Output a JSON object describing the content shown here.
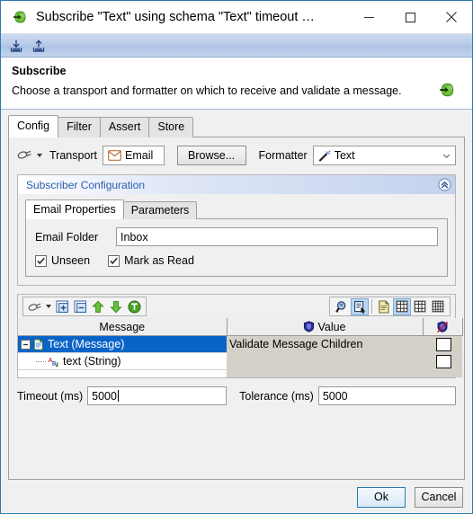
{
  "window": {
    "title": "Subscribe \"Text\" using schema \"Text\" timeout …",
    "title_icon": "green-arrow-icon",
    "minimize_label": "—",
    "maximize_label": "□",
    "close_label": "✕"
  },
  "toolbar": {
    "items": [
      {
        "name": "import-icon",
        "tooltip": "Import"
      },
      {
        "name": "export-icon",
        "tooltip": "Export"
      }
    ]
  },
  "banner": {
    "title": "Subscribe",
    "description": "Choose a transport and formatter on which to receive and validate a message.",
    "icon": "green-arrow-icon"
  },
  "tabs": [
    {
      "label": "Config",
      "active": true
    },
    {
      "label": "Filter",
      "active": false
    },
    {
      "label": "Assert",
      "active": false
    },
    {
      "label": "Store",
      "active": false
    }
  ],
  "config": {
    "pipe_icon": "pipe-icon",
    "transport_label": "Transport",
    "transport_value": "Email",
    "transport_icon": "email-icon",
    "browse_label": "Browse...",
    "formatter_label": "Formatter",
    "formatter_value": "Text",
    "formatter_icon": "magic-wand-icon",
    "group": {
      "title": "Subscriber Configuration",
      "collapse_icon": "chevron-up-double-icon",
      "tabs": [
        {
          "label": "Email Properties",
          "active": true
        },
        {
          "label": "Parameters",
          "active": false
        }
      ],
      "email_folder_label": "Email Folder",
      "email_folder_value": "Inbox",
      "email_folder_placeholder": "",
      "checkboxes": [
        {
          "label": "Unseen",
          "checked": true
        },
        {
          "label": "Mark as Read",
          "checked": true
        }
      ]
    },
    "message_panel": {
      "left_tools": [
        {
          "name": "pipe-icon"
        },
        {
          "name": "chevron-down-icon"
        },
        {
          "name": "add-node-icon"
        },
        {
          "name": "remove-node-icon"
        },
        {
          "name": "move-up-icon"
        },
        {
          "name": "move-down-icon"
        },
        {
          "name": "validate-icon"
        }
      ],
      "right_tools": [
        {
          "name": "zoom-icon",
          "selected": false
        },
        {
          "name": "inspect-icon",
          "selected": true
        },
        {
          "name": "document-icon",
          "selected": false
        },
        {
          "name": "grid-small-icon",
          "selected": true
        },
        {
          "name": "grid-medium-icon",
          "selected": false
        },
        {
          "name": "grid-large-icon",
          "selected": false
        }
      ],
      "columns": [
        {
          "label": "Message",
          "icon": ""
        },
        {
          "label": "Value",
          "icon": "shield-icon"
        },
        {
          "label": "",
          "icon": "shield-disabled-icon"
        }
      ],
      "rows": [
        {
          "name": "Text (Message)",
          "icon": "message-document-icon",
          "expanded": true,
          "selected": true,
          "value": "Validate Message Children",
          "checked": false,
          "depth": 0
        },
        {
          "name": "text (String)",
          "icon": "string-ab-icon",
          "expanded": false,
          "selected": false,
          "value": "",
          "checked": false,
          "depth": 1
        }
      ]
    },
    "timeout_label": "Timeout (ms)",
    "timeout_value": "5000",
    "tolerance_label": "Tolerance (ms)",
    "tolerance_value": "5000"
  },
  "footer": {
    "ok_label": "Ok",
    "cancel_label": "Cancel"
  },
  "colors": {
    "accent_blue": "#2a7ab0",
    "selection_blue": "#0a64c8",
    "group_title_blue": "#2a5db0",
    "green": "#5aa832"
  }
}
